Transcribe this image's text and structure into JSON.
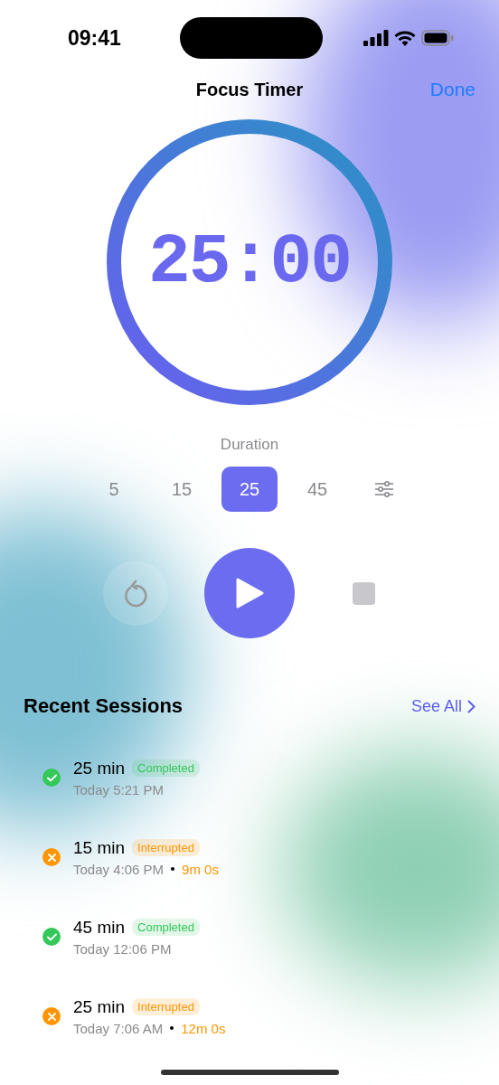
{
  "status_bar": {
    "time": "09:41"
  },
  "nav": {
    "title": "Focus Timer",
    "action": "Done"
  },
  "timer": {
    "display": "25:00",
    "level": 1
  },
  "duration": {
    "label": "Duration",
    "options": [
      {
        "label": "5",
        "selected": false
      },
      {
        "label": "15",
        "selected": false
      },
      {
        "label": "25",
        "selected": true
      },
      {
        "label": "45",
        "selected": false
      }
    ]
  },
  "recent": {
    "title": "Recent Sessions",
    "link": "See All",
    "sessions": [
      {
        "kind": "completed",
        "duration": "25 min",
        "status": "Completed",
        "time": "Today 5:21 PM"
      },
      {
        "kind": "interrupted",
        "duration": "15 min",
        "status": "Interrupted",
        "time": "Today 4:06 PM",
        "elapsed": "9m 0s"
      },
      {
        "kind": "completed",
        "duration": "45 min",
        "status": "Completed",
        "time": "Today 12:06 PM"
      },
      {
        "kind": "interrupted",
        "duration": "25 min",
        "status": "Interrupted",
        "time": "Today 7:06 AM",
        "elapsed": "12m 0s"
      }
    ]
  }
}
